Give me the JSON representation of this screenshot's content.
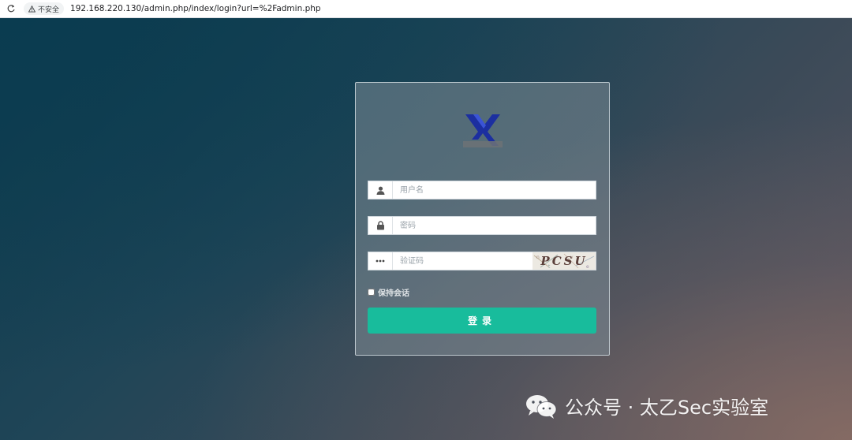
{
  "browser": {
    "security_label": "不安全",
    "url": "192.168.220.130/admin.php/index/login?url=%2Fadmin.php"
  },
  "login": {
    "logo_icon": "xa-logo-icon",
    "username_placeholder": "用户名",
    "password_placeholder": "密码",
    "captcha_placeholder": "验证码",
    "captcha_image_text": "PCSU",
    "remember_label": "保持会话",
    "submit_label": "登录",
    "accent_color": "#18bc9c"
  },
  "watermark": {
    "text": "公众号 · 太乙Sec实验室",
    "icon": "wechat-icon"
  }
}
